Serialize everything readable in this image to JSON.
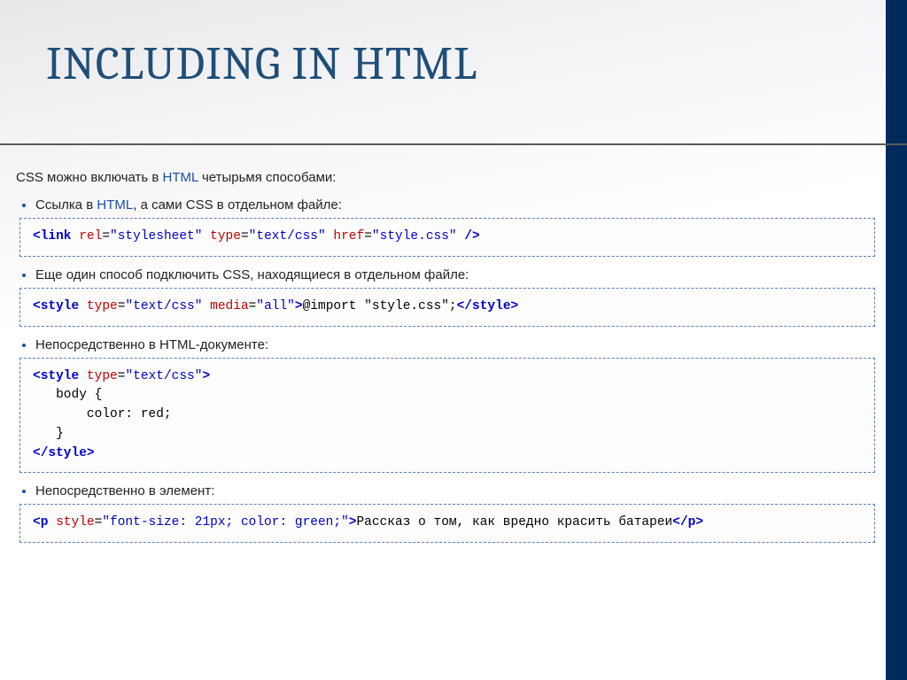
{
  "title": "INCLUDING IN HTML",
  "intro_pre": "CSS можно включать в ",
  "intro_link": "HTML",
  "intro_post": " четырьмя способами:",
  "items": [
    {
      "label_pre": "Ссылка в ",
      "label_link": "HTML",
      "label_post": ", а сами CSS в отдельном файле:"
    },
    {
      "label": "Еще один способ подключить CSS, находящиеся в отдельном файле:"
    },
    {
      "label": "Непосредственно в HTML-документе:"
    },
    {
      "label": "Непосредственно в элемент:"
    }
  ],
  "code1": {
    "tag_open": "<link",
    "a1": " rel",
    "v1": "\"stylesheet\"",
    "a2": " type",
    "v2": "\"text/css\"",
    "a3": " href",
    "v3": "\"style.css\"",
    "close": " />"
  },
  "code2": {
    "tag_open": "<style",
    "a1": " type",
    "v1": "\"text/css\"",
    "a2": " media",
    "v2": "\"all\"",
    "gt": ">",
    "body": "@import \"style.css\";",
    "tag_close": "</style>"
  },
  "code3": {
    "l1_open": "<style",
    "l1_a1": " type",
    "l1_v1": "\"text/css\"",
    "l1_gt": ">",
    "l2": "   body {",
    "l3": "       color: red;",
    "l4": "   }",
    "l5": "</style>"
  },
  "code4": {
    "tag_open": "<p",
    "a1": " style",
    "v1": "\"font-size: 21px; color: green;\"",
    "gt": ">",
    "text": "Рассказ о том, как вредно красить батареи",
    "tag_close": "</p>"
  }
}
